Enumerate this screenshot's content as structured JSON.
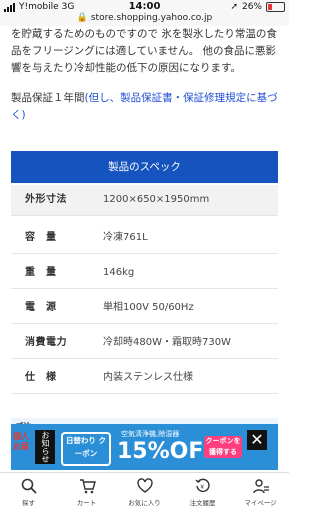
{
  "status_bar": {
    "carrier": "Y!mobile",
    "network": "3G",
    "time": "14:00",
    "battery": "26%",
    "url": "store.shopping.yahoo.co.jp"
  },
  "description": {
    "text": "を貯蔵するためのものですので 氷を製氷したり常温の食品をフリージングには適していません。 他の食品に悪影響を与えたり冷却性能の低下の原因になります。"
  },
  "warranty": {
    "prefix": "製品保証１年間",
    "link": "(但し、製品保証書・保証修理規定に基づく)"
  },
  "spec": {
    "header": "製品のスペック",
    "rows": [
      {
        "key": "外形寸法",
        "value": "1200×650×1950mm"
      },
      {
        "key": "容　量",
        "value": "冷凍761L"
      },
      {
        "key": "重　量",
        "value": "146kg"
      },
      {
        "key": "電　源",
        "value": "単相100V 50/60Hz"
      },
      {
        "key": "消費電力",
        "value": "冷却時480W・霜取時730W"
      },
      {
        "key": "仕　様",
        "value": "内装ステンレス仕様"
      }
    ]
  },
  "promo": {
    "strip_text": "ご注",
    "side_label": "個人 お届",
    "tag": "お知らせ",
    "daily_coupon": "日替わり クーポン",
    "sub_text": "空気清浄機,除湿器",
    "off_text": "15%OFF",
    "cta": "クーポンを 獲得する",
    "close": "✕"
  },
  "bottom_nav": {
    "items": [
      {
        "label": "探す",
        "icon": "search-icon"
      },
      {
        "label": "カート",
        "icon": "cart-icon"
      },
      {
        "label": "お気に入り",
        "icon": "heart-icon"
      },
      {
        "label": "注文履歴",
        "icon": "history-icon"
      },
      {
        "label": "マイページ",
        "icon": "user-icon"
      }
    ]
  },
  "colors": {
    "spec_header": "#1553bf",
    "link": "#1f4fd1",
    "promo_bg": "#2a8fd7",
    "cta": "#ff3d7f"
  }
}
